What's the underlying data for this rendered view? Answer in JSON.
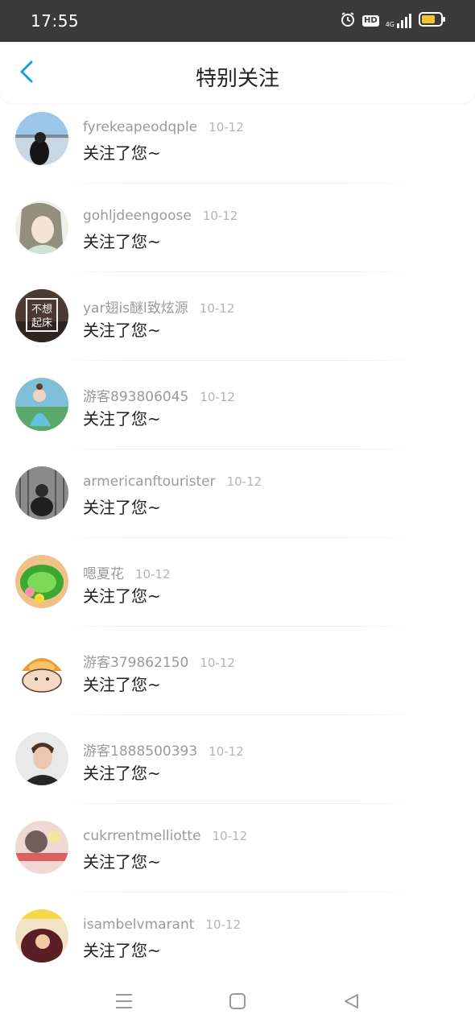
{
  "status_bar": {
    "time": "17:55",
    "icons": [
      "alarm-icon",
      "hd-icon",
      "signal-4g-icon",
      "battery-icon"
    ],
    "hd_label": "HD",
    "network_label": "4G",
    "battery_color": "#f4c430"
  },
  "header": {
    "title": "特别关注",
    "back_icon": "chevron-left-icon",
    "accent": "#1a9be6"
  },
  "items": [
    {
      "name": "fyrekeapeodqple",
      "date": "10-12",
      "message": "关注了您~"
    },
    {
      "name": "gohljdeengoose",
      "date": "10-12",
      "message": "关注了您~"
    },
    {
      "name": "yar翅is醚l致炫源",
      "date": "10-12",
      "message": "关注了您~"
    },
    {
      "name": "游客893806045",
      "date": "10-12",
      "message": "关注了您~"
    },
    {
      "name": "armericanftourister",
      "date": "10-12",
      "message": "关注了您~"
    },
    {
      "name": "嗯夏花",
      "date": "10-12",
      "message": "关注了您~"
    },
    {
      "name": "游客379862150",
      "date": "10-12",
      "message": "关注了您~"
    },
    {
      "name": "游客1888500393",
      "date": "10-12",
      "message": "关注了您~"
    },
    {
      "name": "cukrrentmelliotte",
      "date": "10-12",
      "message": "关注了您~"
    },
    {
      "name": "isambelvmarant",
      "date": "10-12",
      "message": "关注了您~"
    }
  ],
  "avatar_text": {
    "third": "不想起床"
  },
  "bottom_nav": {
    "icons": [
      "menu-icon",
      "home-square-icon",
      "back-triangle-icon"
    ]
  }
}
